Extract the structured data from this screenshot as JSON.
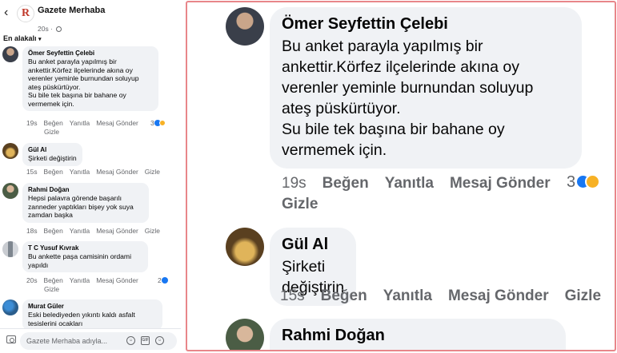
{
  "header": {
    "page_name": "Gazete Merhaba",
    "post_time": "20s",
    "sort_label": "En alakalı"
  },
  "comments": [
    {
      "name": "Ömer Seyfettin Çelebi",
      "text": "Bu anket parayla yapılmış bir\nankettir.Körfez ilçelerinde akına oy\nverenler yeminle burnundan soluyup\nateş püskürtüyor.\nSu bile tek başına bir bahane oy\nvermemek için.",
      "time": "19s",
      "like": "Beğen",
      "reply": "Yanıtla",
      "message": "Mesaj Gönder",
      "hide": "Gizle",
      "reaction_count": "3"
    },
    {
      "name": "Gül Al",
      "text": "Şirketi değiştirin",
      "time": "15s",
      "like": "Beğen",
      "reply": "Yanıtla",
      "message": "Mesaj Gönder",
      "hide": "Gizle"
    },
    {
      "name": "Rahmi Doğan",
      "text": "Hepsi palavra görende başarılı\nzanneder yaptıkları bişey yok suya\nzamdan başka",
      "time": "18s",
      "like": "Beğen",
      "reply": "Yanıtla",
      "message": "Mesaj Gönder",
      "hide": "Gizle"
    },
    {
      "name": "T C Yusuf Kıvrak",
      "text": "Bu ankette paşa camisinin ordami\nyapıldı",
      "time": "20s",
      "like": "Beğen",
      "reply": "Yanıtla",
      "message": "Mesaj Gönder",
      "hide": "Gizle",
      "reaction_count": "2"
    },
    {
      "name": "Murat Güler",
      "text": "Eski belediyeden yıkıntı kaldı asfalt\ntesislerini ocakları"
    }
  ],
  "composer": {
    "placeholder": "Gazete Merhaba adıyla..."
  },
  "icons": {
    "back": "chevron-left-icon",
    "globe": "globe-icon",
    "camera": "camera-icon",
    "emoji": "emoji-icon",
    "gif": "gif-icon",
    "sticker": "sticker-icon"
  },
  "colors": {
    "bubble": "#f0f2f5",
    "meta_text": "#65676b",
    "like_blue": "#1877f2",
    "haha_yellow": "#f7b125",
    "highlight_frame": "#e8868a",
    "logo_red": "#c0392b"
  }
}
